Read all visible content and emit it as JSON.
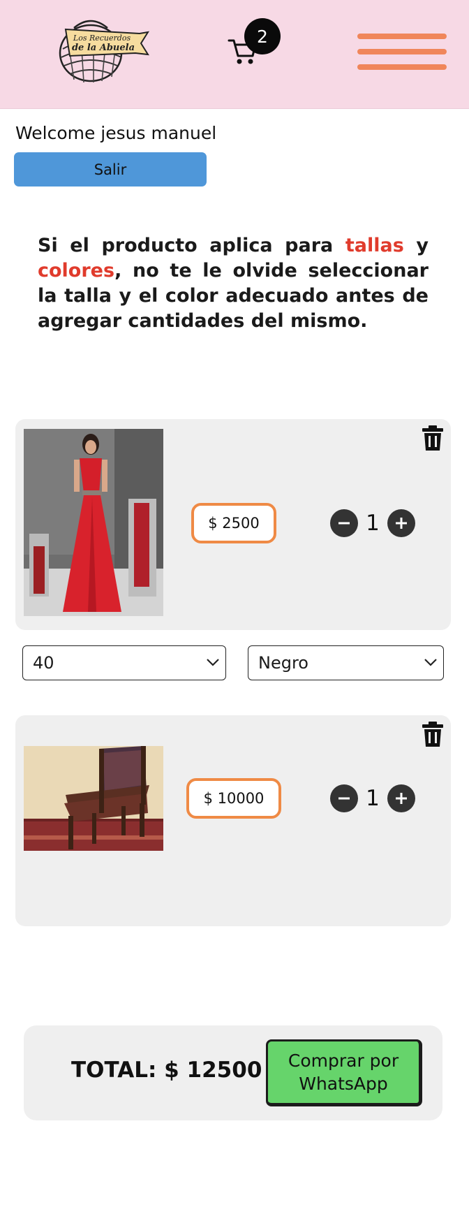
{
  "header": {
    "logo_text_line1": "Los Recuerdos",
    "logo_text_line2": "de la Abuela",
    "cart_count": "2",
    "cart_icon": "cart-icon",
    "menu_icon": "hamburger-menu-icon"
  },
  "user": {
    "welcome": "Welcome jesus manuel",
    "logout_label": "Salir"
  },
  "notice": {
    "part1": "Si el producto aplica para ",
    "highlight1": "tallas",
    "part2": " y ",
    "highlight2": "colores",
    "part3": ", no te le olvide seleccionar la talla y el color adecuado antes de agregar cantidades del mismo."
  },
  "cart_items": [
    {
      "image_icon": "red-dress-photo",
      "price": "$ 2500",
      "quantity": "1",
      "size": "40",
      "color": "Negro"
    },
    {
      "image_icon": "antique-chair-photo",
      "price": "$ 10000",
      "quantity": "1"
    }
  ],
  "footer": {
    "total": "TOTAL: $ 12500",
    "buy_label": "Comprar por WhatsApp"
  },
  "colors": {
    "header_bg": "#f7d9e5",
    "menu_accent": "#f0865a",
    "logout_btn": "#4f97d9",
    "highlight_red": "#e03b2c",
    "price_border": "#ef8a45",
    "buy_btn": "#66d46b"
  }
}
